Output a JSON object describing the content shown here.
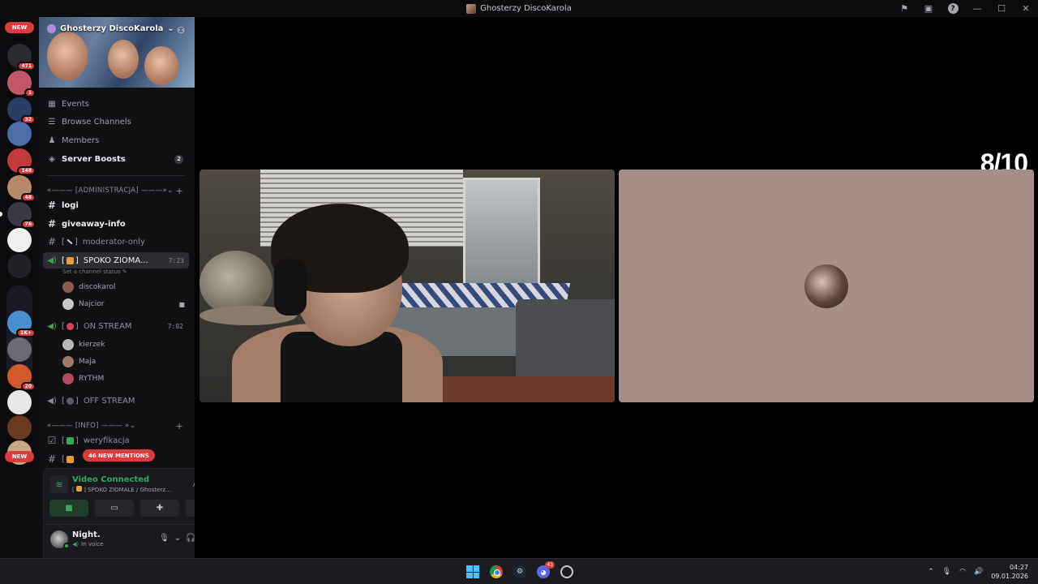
{
  "window": {
    "title": "Ghosterzy DiscoKarola"
  },
  "rail": {
    "top_pill": "NEW",
    "bottom_pill": "NEW",
    "servers": [
      {
        "name": "server-1",
        "badge": "471",
        "color": "#2a2a30"
      },
      {
        "name": "server-2",
        "badge": "1",
        "color": "#c2576a"
      },
      {
        "name": "server-3",
        "badge": "32",
        "color": "#2a3d63"
      },
      {
        "name": "server-4",
        "badge": "",
        "color": "#4a6fa8"
      },
      {
        "name": "server-5",
        "badge": "148",
        "color": "#c23a3a"
      },
      {
        "name": "server-6",
        "badge": "48",
        "color": "#b58a6a"
      },
      {
        "name": "server-7",
        "badge": "76",
        "color": "#3a3a46"
      },
      {
        "name": "server-8",
        "badge": "",
        "color": "#f0f0f0"
      },
      {
        "name": "server-9",
        "badge": "",
        "color": "#202026"
      },
      {
        "name": "server-10",
        "badge": "1K+",
        "color": "#4c8fd0"
      },
      {
        "name": "server-11",
        "badge": "",
        "color": "#6a6a72"
      },
      {
        "name": "server-12",
        "badge": "20",
        "color": "#d05a2a"
      },
      {
        "name": "server-13",
        "badge": "",
        "color": "#e8e8e8"
      },
      {
        "name": "server-14",
        "badge": "",
        "color": "#6a3a22"
      },
      {
        "name": "server-15",
        "badge": "",
        "color": "#c8a68a"
      }
    ]
  },
  "sidebar": {
    "server_name": "Ghosterzy DiscoKarola",
    "menu": [
      {
        "icon": "calendar-icon",
        "glyph": "▦",
        "label": "Events"
      },
      {
        "icon": "browse-icon",
        "glyph": "☰",
        "label": "Browse Channels"
      },
      {
        "icon": "members-icon",
        "glyph": "♟",
        "label": "Members"
      },
      {
        "icon": "boost-icon",
        "glyph": "◈",
        "label": "Server Boosts",
        "count": "2"
      }
    ],
    "categories": {
      "admin": "«——— [ADMINISTRACJA] ———» ",
      "info": "«——— [INFO] ——— »"
    },
    "channels": {
      "logi": "logi",
      "giveaway": "giveaway-info",
      "moderator": "moderator-only",
      "spoko": "SPOKO ZIOMA...",
      "spoko_time": "7:23",
      "spoko_status": "Set a channel status",
      "on_stream": "ON STREAM",
      "on_stream_time": "7:02",
      "off_stream": "OFF STREAM",
      "weryfikacja": "weryfikacja"
    },
    "voice_users_spoko": [
      {
        "name": "discokarol"
      },
      {
        "name": "Najcior"
      }
    ],
    "voice_users_stream": [
      {
        "name": "kierzek"
      },
      {
        "name": "Maja"
      },
      {
        "name": "RYTHM"
      }
    ],
    "mentions_pill": "46 NEW MENTIONS"
  },
  "voice_panel": {
    "title": "Video Connected",
    "subtitle": "SPOKO ZIOMALE / Ghosterz..."
  },
  "user_panel": {
    "name": "Night.",
    "status": "In voice"
  },
  "stage": {
    "score": "8/10"
  },
  "taskbar": {
    "discord_badge": "41",
    "time": "04:27",
    "date": "09.01.2026"
  }
}
